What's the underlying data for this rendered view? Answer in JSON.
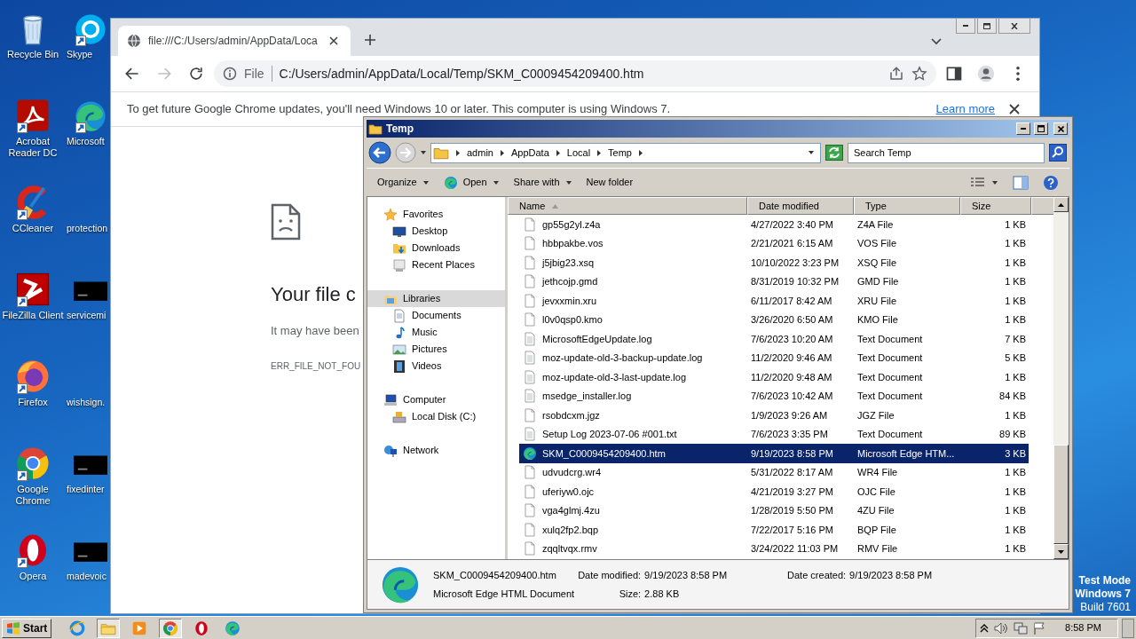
{
  "desktop": {
    "columns": [
      [
        {
          "label": "Recycle Bin",
          "kind": "recycle",
          "shortcut": false
        },
        {
          "label": "Acrobat Reader DC",
          "kind": "acrobat",
          "shortcut": true
        },
        {
          "label": "CCleaner",
          "kind": "ccleaner",
          "shortcut": true
        },
        {
          "label": "FileZilla Client",
          "kind": "filezilla",
          "shortcut": true
        },
        {
          "label": "Firefox",
          "kind": "firefox",
          "shortcut": true
        },
        {
          "label": "Google Chrome",
          "kind": "chrome",
          "shortcut": true
        },
        {
          "label": "Opera",
          "kind": "opera",
          "shortcut": true
        }
      ],
      [
        {
          "label": "Skype",
          "kind": "skype",
          "shortcut": true
        },
        {
          "label": "Microsoft",
          "kind": "edge",
          "shortcut": true
        },
        {
          "label": "protection",
          "kind": "none",
          "shortcut": false
        },
        {
          "label": "servicemi",
          "kind": "console",
          "shortcut": false
        },
        {
          "label": "wishsign.",
          "kind": "none",
          "shortcut": false
        },
        {
          "label": "fixedinter",
          "kind": "console",
          "shortcut": false
        },
        {
          "label": "madevoic",
          "kind": "console",
          "shortcut": false
        }
      ]
    ],
    "watermark": [
      {
        "text": "Test Mode",
        "bold": true
      },
      {
        "text": "Windows 7",
        "bold": true
      },
      {
        "text": "Build 7601",
        "bold": false
      }
    ]
  },
  "browser": {
    "tab": {
      "title": "file:///C:/Users/admin/AppData/Loca",
      "selected": true
    },
    "forward_disabled": true,
    "address": {
      "scheme": "File",
      "url": "C:/Users/admin/AppData/Local/Temp/SKM_C0009454209400.htm"
    },
    "infobar": {
      "message": "To get future Google Chrome updates, you'll need Windows 10 or later. This computer is using Windows 7.",
      "link": "Learn more"
    },
    "error": {
      "heading": "Your file c",
      "message": "It may have been",
      "code": "ERR_FILE_NOT_FOU"
    }
  },
  "explorer": {
    "title": "Temp",
    "forward_disabled": true,
    "breadcrumb": [
      "admin",
      "AppData",
      "Local",
      "Temp"
    ],
    "search": {
      "placeholder": "Search Temp"
    },
    "commands": [
      {
        "label": "Organize",
        "kind": "plain",
        "menu": true
      },
      {
        "label": "Open",
        "kind": "edge",
        "menu": true
      },
      {
        "label": "Share with",
        "kind": "plain",
        "menu": true
      },
      {
        "label": "New folder",
        "kind": "plain",
        "menu": false
      }
    ],
    "nav": [
      {
        "label": "Favorites",
        "kind": "star",
        "selected": false,
        "children": [
          {
            "label": "Desktop",
            "kind": "desktop",
            "selected": false
          },
          {
            "label": "Downloads",
            "kind": "downloads",
            "selected": false
          },
          {
            "label": "Recent Places",
            "kind": "recent",
            "selected": false
          }
        ]
      },
      {
        "label": "Libraries",
        "kind": "library",
        "selected": true,
        "children": [
          {
            "label": "Documents",
            "kind": "documents",
            "selected": false
          },
          {
            "label": "Music",
            "kind": "music",
            "selected": false
          },
          {
            "label": "Pictures",
            "kind": "pictures",
            "selected": false
          },
          {
            "label": "Videos",
            "kind": "videos",
            "selected": false
          }
        ]
      },
      {
        "label": "Computer",
        "kind": "computer",
        "selected": false,
        "children": [
          {
            "label": "Local Disk (C:)",
            "kind": "disk",
            "selected": false
          }
        ]
      },
      {
        "label": "Network",
        "kind": "network",
        "selected": false
      }
    ],
    "columns": [
      {
        "label": "Name",
        "sorted": true
      },
      {
        "label": "Date modified",
        "sorted": false
      },
      {
        "label": "Type",
        "sorted": false
      },
      {
        "label": "Size",
        "sorted": false
      }
    ],
    "files": [
      {
        "name": "gp55g2yl.z4a",
        "date": "4/27/2022 3:40 PM",
        "type": "Z4A File",
        "size": "1 KB",
        "kind": "blank",
        "selected": false
      },
      {
        "name": "hbbpakbe.vos",
        "date": "2/21/2021 6:15 AM",
        "type": "VOS File",
        "size": "1 KB",
        "kind": "blank",
        "selected": false
      },
      {
        "name": "j5jbig23.xsq",
        "date": "10/10/2022 3:23 PM",
        "type": "XSQ File",
        "size": "1 KB",
        "kind": "blank",
        "selected": false
      },
      {
        "name": "jethcojp.gmd",
        "date": "8/31/2019 10:32 PM",
        "type": "GMD File",
        "size": "1 KB",
        "kind": "blank",
        "selected": false
      },
      {
        "name": "jevxxmin.xru",
        "date": "6/11/2017 8:42 AM",
        "type": "XRU File",
        "size": "1 KB",
        "kind": "blank",
        "selected": false
      },
      {
        "name": "l0v0qsp0.kmo",
        "date": "3/26/2020 6:50 AM",
        "type": "KMO File",
        "size": "1 KB",
        "kind": "blank",
        "selected": false
      },
      {
        "name": "MicrosoftEdgeUpdate.log",
        "date": "7/6/2023 10:20 AM",
        "type": "Text Document",
        "size": "7 KB",
        "kind": "text",
        "selected": false
      },
      {
        "name": "moz-update-old-3-backup-update.log",
        "date": "11/2/2020 9:46 AM",
        "type": "Text Document",
        "size": "5 KB",
        "kind": "text",
        "selected": false
      },
      {
        "name": "moz-update-old-3-last-update.log",
        "date": "11/2/2020 9:48 AM",
        "type": "Text Document",
        "size": "1 KB",
        "kind": "text",
        "selected": false
      },
      {
        "name": "msedge_installer.log",
        "date": "7/6/2023 10:42 AM",
        "type": "Text Document",
        "size": "84 KB",
        "kind": "text",
        "selected": false
      },
      {
        "name": "rsobdcxm.jgz",
        "date": "1/9/2023 9:26 AM",
        "type": "JGZ File",
        "size": "1 KB",
        "kind": "blank",
        "selected": false
      },
      {
        "name": "Setup Log 2023-07-06 #001.txt",
        "date": "7/6/2023 3:35 PM",
        "type": "Text Document",
        "size": "89 KB",
        "kind": "text",
        "selected": false
      },
      {
        "name": "SKM_C0009454209400.htm",
        "date": "9/19/2023 8:58 PM",
        "type": "Microsoft Edge HTM...",
        "size": "3 KB",
        "kind": "edge",
        "selected": true
      },
      {
        "name": "udvudcrg.wr4",
        "date": "5/31/2022 8:17 AM",
        "type": "WR4 File",
        "size": "1 KB",
        "kind": "blank",
        "selected": false
      },
      {
        "name": "uferiyw0.ojc",
        "date": "4/21/2019 3:27 PM",
        "type": "OJC File",
        "size": "1 KB",
        "kind": "blank",
        "selected": false
      },
      {
        "name": "vga4glmj.4zu",
        "date": "1/28/2019 5:50 PM",
        "type": "4ZU File",
        "size": "1 KB",
        "kind": "blank",
        "selected": false
      },
      {
        "name": "xulq2fp2.bqp",
        "date": "7/22/2017 5:16 PM",
        "type": "BQP File",
        "size": "1 KB",
        "kind": "blank",
        "selected": false
      },
      {
        "name": "zqqltvqx.rmv",
        "date": "3/24/2022 11:03 PM",
        "type": "RMV File",
        "size": "1 KB",
        "kind": "blank",
        "selected": false
      }
    ],
    "details": {
      "name": "SKM_C0009454209400.htm",
      "type": "Microsoft Edge HTML Document",
      "fields": [
        {
          "label": "Date modified:",
          "value": "9/19/2023 8:58 PM"
        },
        {
          "label": "Size:",
          "value": "2.88 KB"
        },
        {
          "label": "Date created:",
          "value": "9/19/2023 8:58 PM"
        }
      ]
    }
  },
  "taskbar": {
    "start": "Start",
    "apps": [
      {
        "kind": "ie",
        "active": false
      },
      {
        "kind": "explorer",
        "active": true
      },
      {
        "kind": "media",
        "active": false
      },
      {
        "kind": "chrome",
        "active": true
      },
      {
        "kind": "opera",
        "active": false
      },
      {
        "kind": "edge",
        "active": false
      }
    ],
    "clock": "8:58 PM"
  }
}
